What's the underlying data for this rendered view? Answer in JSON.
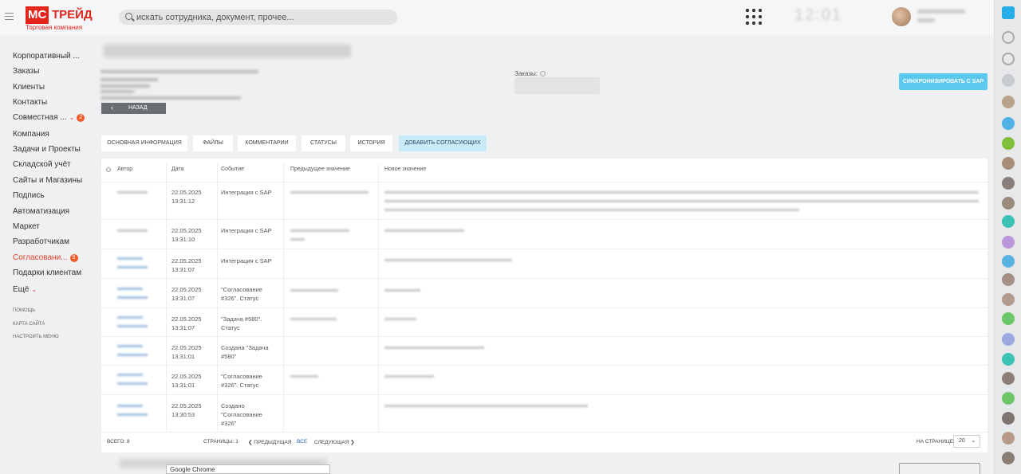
{
  "header": {
    "logo_mark": "МС",
    "logo_word": "ТРЕЙД",
    "logo_sub": "Торговая компания",
    "search_placeholder": "искать сотрудника, документ, прочее..."
  },
  "menu": {
    "items": [
      {
        "label": "Корпоративный ..."
      },
      {
        "label": "Заказы"
      },
      {
        "label": "Клиенты"
      },
      {
        "label": "Контакты"
      },
      {
        "label": "Совместная ...",
        "badge": "2"
      },
      {
        "label": "Компания"
      },
      {
        "label": "Задачи и Проекты"
      },
      {
        "label": "Складской учёт"
      },
      {
        "label": "Сайты и Магазины"
      },
      {
        "label": "Подпись"
      },
      {
        "label": "Автоматизация"
      },
      {
        "label": "Маркет"
      },
      {
        "label": "Разработчикам"
      },
      {
        "label": "Согласовани...",
        "badge": "9"
      },
      {
        "label": "Подарки клиентам"
      },
      {
        "label": "Ещё"
      }
    ],
    "help": "ПОМОЩЬ",
    "sitemap": "КАРТА САЙТА",
    "settings": "НАСТРОИТЬ МЕНЮ"
  },
  "content": {
    "back_label": "НАЗАД",
    "orders_label": "Заказы:",
    "sync_label": "СИНХРОНИЗИРОВАТЬ С SAP"
  },
  "tabs": [
    {
      "label": "ОСНОВНАЯ ИНФОРМАЦИЯ"
    },
    {
      "label": "ФАЙЛЫ"
    },
    {
      "label": "КОММЕНТАРИИ"
    },
    {
      "label": "СТАТУСЫ"
    },
    {
      "label": "ИСТОРИЯ"
    },
    {
      "label": "ДОБАВИТЬ СОГЛАСУЮЩИХ"
    }
  ],
  "table": {
    "headers": {
      "author": "Автор",
      "date": "Дата",
      "event": "Событие",
      "prev": "Предыдущее значение",
      "new": "Новое значение"
    },
    "rows": [
      {
        "date": "22.05.2025",
        "time": "13:31:12",
        "event": [
          "Интеграция с SAP"
        ]
      },
      {
        "date": "22.05.2025",
        "time": "13:31:10",
        "event": [
          "Интеграция с SAP"
        ]
      },
      {
        "date": "22.05.2025",
        "time": "13:31:07",
        "event": [
          "Интеграция с SAP"
        ]
      },
      {
        "date": "22.05.2025",
        "time": "13:31:07",
        "event": [
          "\"Согласование",
          "#326\". Статус"
        ]
      },
      {
        "date": "22.05.2025",
        "time": "13:31:07",
        "event": [
          "\"Задача #580\".",
          "Статус"
        ]
      },
      {
        "date": "22.05.2025",
        "time": "13:31:01",
        "event": [
          "Создана \"Задача",
          "#580\""
        ]
      },
      {
        "date": "22.05.2025",
        "time": "13:31:01",
        "event": [
          "\"Согласование",
          "#326\". Статус"
        ]
      },
      {
        "date": "22.05.2025",
        "time": "13:30:53",
        "event": [
          "Создано",
          "\"Согласование",
          "#326\""
        ]
      }
    ]
  },
  "footer": {
    "total": "ВСЕГО: 8",
    "pages": "СТРАНИЦЫ: 1",
    "prev": "ПРЕДЫДУЩАЯ",
    "all": "ВСЕ",
    "next": "СЛЕДУЮЩАЯ",
    "per_page_label": "НА СТРАНИЦЕ:",
    "per_page_value": "20"
  },
  "tooltip": "Google Chrome"
}
